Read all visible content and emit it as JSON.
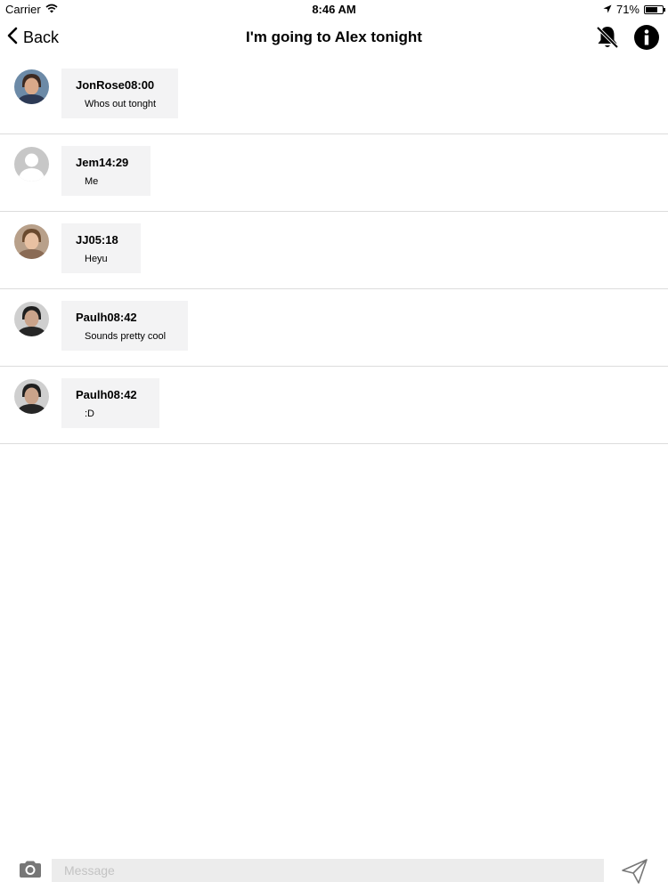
{
  "status_bar": {
    "carrier": "Carrier",
    "time": "8:46 AM",
    "battery": "71%",
    "battery_level": 0.71
  },
  "nav": {
    "back_label": "Back",
    "title": "I'm going to Alex tonight"
  },
  "messages": [
    {
      "sender": "JonRose",
      "time": "08:00",
      "text": "Whos out tonght",
      "avatar": "photo"
    },
    {
      "sender": "Jem",
      "time": "14:29",
      "text": "Me",
      "avatar": "placeholder"
    },
    {
      "sender": "JJ",
      "time": "05:18",
      "text": "Heyu",
      "avatar": "photo"
    },
    {
      "sender": "Paulh",
      "time": "08:42",
      "text": "Sounds pretty cool",
      "avatar": "photo"
    },
    {
      "sender": "Paulh",
      "time": "08:42",
      "text": ":D",
      "avatar": "photo"
    }
  ],
  "input": {
    "placeholder": "Message",
    "value": ""
  },
  "icons": {
    "back": "chevron-left-icon",
    "mute": "bell-slash-icon",
    "info": "info-icon",
    "camera": "camera-icon",
    "send": "paper-plane-icon",
    "wifi": "wifi-icon",
    "location": "location-arrow-icon"
  },
  "colors": {
    "bubble": "#f3f3f4",
    "divider": "#dcdcdc",
    "input_bg": "#ececec"
  }
}
